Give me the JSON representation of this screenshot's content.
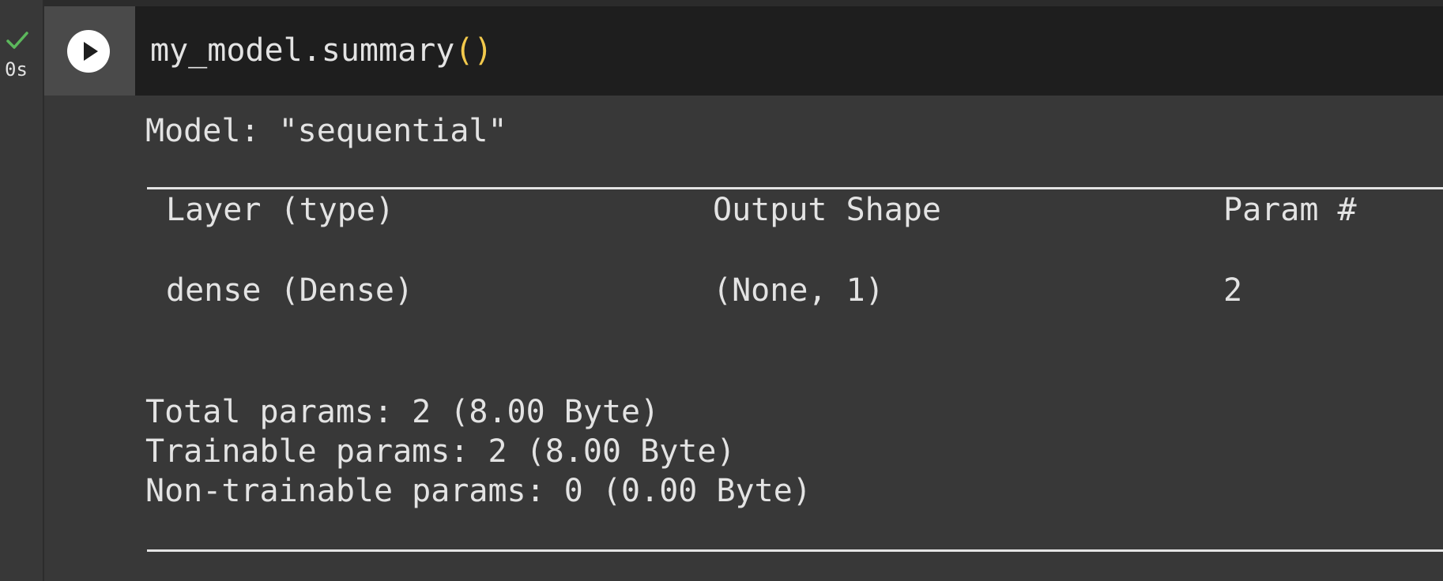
{
  "cell": {
    "status": "success",
    "exec_time": "0s",
    "code_text": "my_model.summary",
    "code_parens": "()"
  },
  "output": {
    "model_line": "Model: \"sequential\"",
    "table": {
      "headers": [
        "Layer (type)",
        "Output Shape",
        "Param #"
      ],
      "rows": [
        [
          "dense (Dense)",
          "(None, 1)",
          "2"
        ]
      ]
    },
    "separator": "====================================================================================================",
    "total_params": "Total params: 2 (8.00 Byte)",
    "trainable_params": "Trainable params: 2 (8.00 Byte)",
    "non_trainable_params": "Non-trainable params: 0 (0.00 Byte)"
  },
  "colors": {
    "success_check": "#5cb85c",
    "paren": "#f2c94c",
    "code_bg": "#1e1e1e",
    "output_bg": "#383838"
  },
  "icons": {
    "status": "check-icon",
    "run": "play-icon"
  }
}
